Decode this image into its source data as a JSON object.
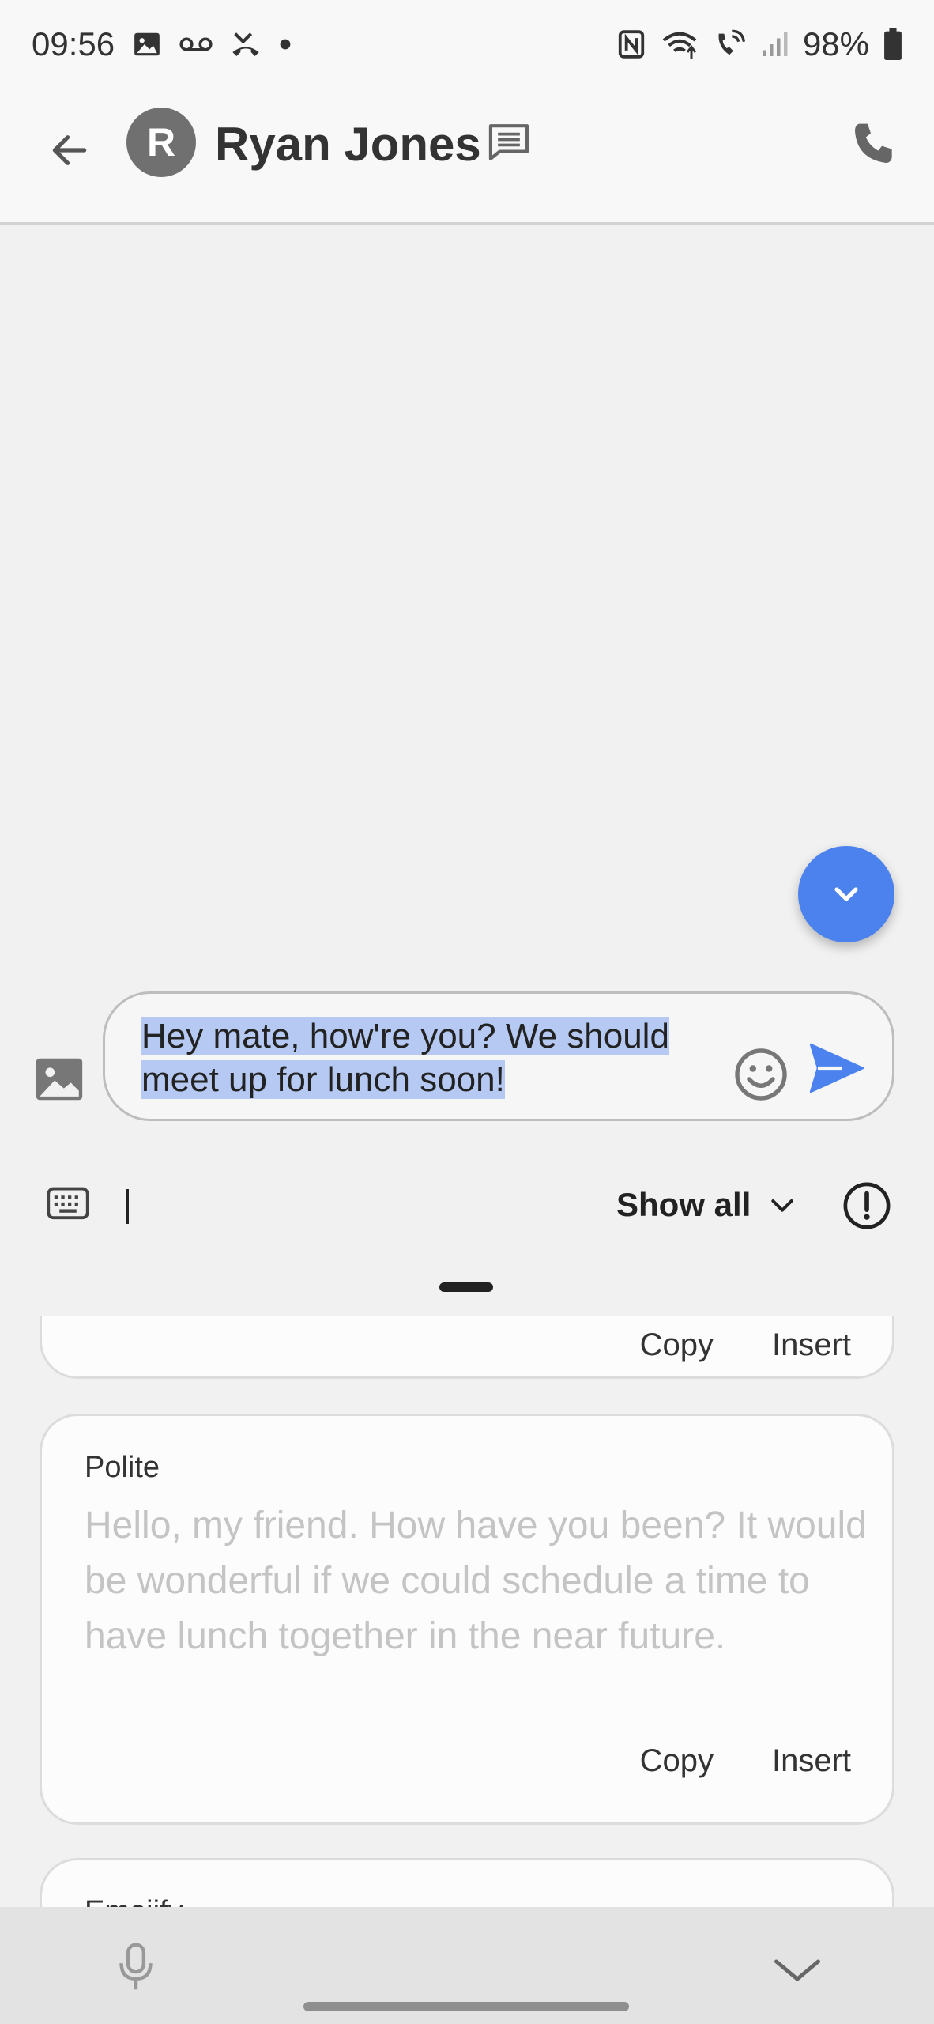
{
  "status_bar": {
    "time": "09:56",
    "battery": "98%",
    "icons": [
      "gallery-icon",
      "voicemail-icon",
      "missed-call-icon",
      "dot-icon",
      "nfc-icon",
      "wifi-icon",
      "wifi-calling-icon",
      "signal-icon",
      "battery-icon"
    ]
  },
  "header": {
    "avatar_initial": "R",
    "contact_name": "Ryan Jones"
  },
  "composer": {
    "message_text": "Hey mate, how're you? We should meet up for lunch soon!"
  },
  "keyboard_toolbar": {
    "show_all_label": "Show all"
  },
  "suggestions": [
    {
      "label": "",
      "text": "",
      "copy_label": "Copy",
      "insert_label": "Insert"
    },
    {
      "label": "Polite",
      "text": "Hello, my friend. How have you been? It would be wonderful if we could schedule a time to have lunch together in the near future.",
      "copy_label": "Copy",
      "insert_label": "Insert"
    },
    {
      "label": "Emojify",
      "text": "",
      "copy_label": "",
      "insert_label": ""
    }
  ],
  "colors": {
    "accent": "#4b82ee",
    "selection": "#b6c9f2",
    "avatar": "#707070"
  }
}
